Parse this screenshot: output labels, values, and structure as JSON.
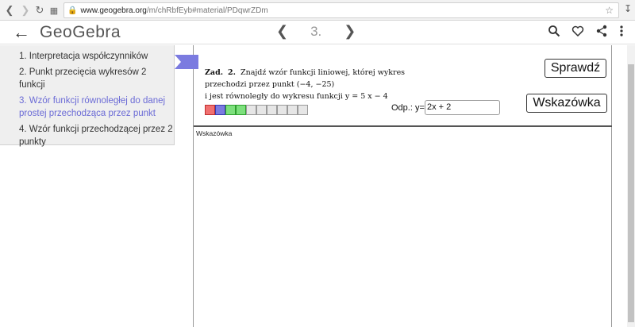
{
  "browser": {
    "url_host": "www.geogebra.org",
    "url_path": "/m/chRbfEyb#material/PDqwrZDm"
  },
  "header": {
    "logo": "GeoGebra",
    "page_number": "3."
  },
  "sidebar": {
    "items": [
      {
        "label": "1. Interpretacja współczynników",
        "active": false
      },
      {
        "label": "2. Punkt przecięcia wykresów 2 funkcji",
        "active": false
      },
      {
        "label": "3. Wzór funkcji równoległej do danej prostej przechodząca przez punkt",
        "active": true
      },
      {
        "label": "4. Wzór funkcji przechodzącej przez 2 punkty",
        "active": false
      }
    ]
  },
  "task": {
    "prefix": "Zad.",
    "number": "2.",
    "line1": "Znajdź wzór funkcji liniowej, której wykres",
    "line2": "przechodzi przez punkt (−4, −25)",
    "line3": "i jest równoległy do wykresu funkcji y = 5 x − 4",
    "progress": [
      "red",
      "blue",
      "green",
      "green",
      "gray",
      "gray",
      "gray",
      "gray",
      "gray",
      "gray"
    ]
  },
  "controls": {
    "check_label": "Sprawdź",
    "hint_label": "Wskazówka",
    "answer_label": "Odp.: y=",
    "answer_value": "2x + 2"
  },
  "hint_area": {
    "label": "Wskazówka"
  },
  "colors": {
    "accent": "#6b6bd6",
    "flag": "#7b7be0"
  }
}
